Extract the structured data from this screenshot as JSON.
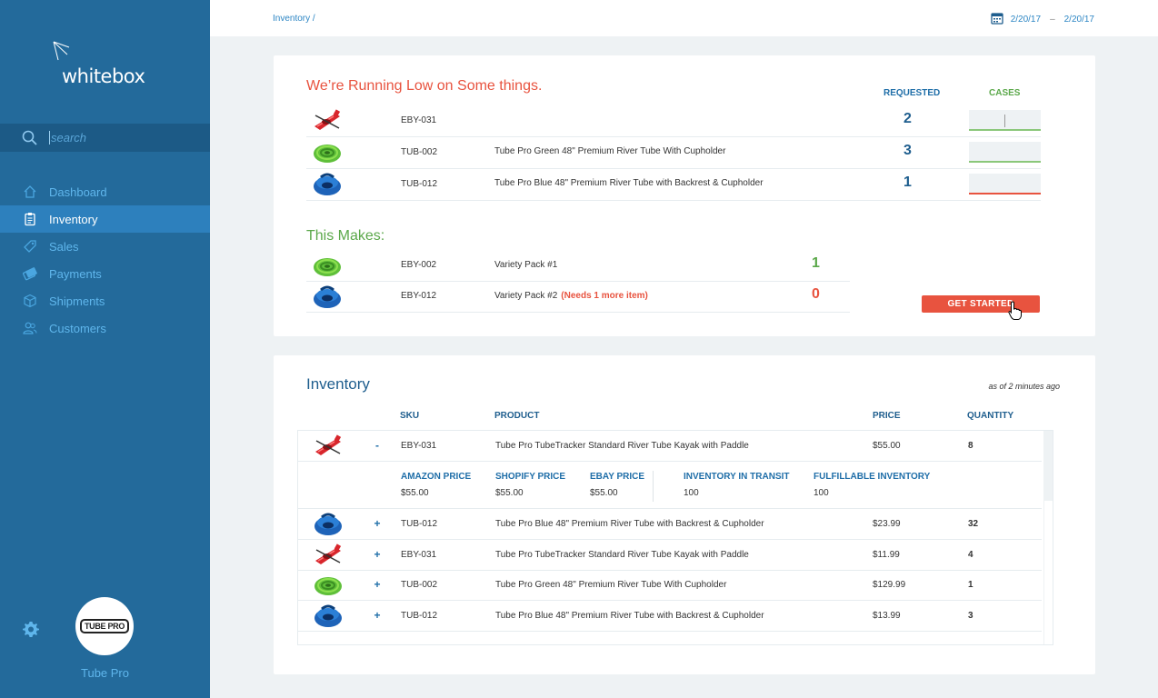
{
  "app": {
    "logo": "whitebox",
    "brand_name": "Tube Pro",
    "brand_badge": "TUBE PRO"
  },
  "search": {
    "placeholder": "search"
  },
  "nav": [
    {
      "label": "Dashboard",
      "icon": "home-icon"
    },
    {
      "label": "Inventory",
      "icon": "clipboard-icon",
      "active": true
    },
    {
      "label": "Sales",
      "icon": "tag-icon"
    },
    {
      "label": "Payments",
      "icon": "payments-icon"
    },
    {
      "label": "Shipments",
      "icon": "box-icon"
    },
    {
      "label": "Customers",
      "icon": "users-icon"
    }
  ],
  "breadcrumb": "Inventory /",
  "date_range": {
    "start": "2/20/17",
    "separator": "–",
    "end": "2/20/17"
  },
  "low_stock": {
    "title": "We’re Running Low on Some things.",
    "col_requested": "REQUESTED",
    "col_cases": "CASES",
    "rows": [
      {
        "sku": "EBY-031",
        "product": "",
        "requested": "2",
        "thumb": "kayak-red"
      },
      {
        "sku": "TUB-002",
        "product": "Tube Pro Green 48\" Premium River Tube With Cupholder",
        "requested": "3",
        "thumb": "tube-green"
      },
      {
        "sku": "TUB-012",
        "product": "Tube Pro Blue 48\" Premium River Tube with Backrest & Cupholder",
        "requested": "1",
        "thumb": "tube-blue"
      }
    ]
  },
  "makes": {
    "title": "This Makes:",
    "rows": [
      {
        "sku": "EBY-002",
        "product": "Variety Pack #1",
        "note": "",
        "qty": "1",
        "thumb": "tube-green"
      },
      {
        "sku": "EBY-012",
        "product": "Variety Pack #2",
        "note": "(Needs 1 more item)",
        "qty": "0",
        "thumb": "tube-blue"
      }
    ],
    "button": "GET STARTED"
  },
  "inventory": {
    "title": "Inventory",
    "as_of": "as of 2 minutes ago",
    "headers": {
      "sku": "SKU",
      "product": "PRODUCT",
      "price": "PRICE",
      "quantity": "QUANTITY"
    },
    "rows": [
      {
        "toggle": "-",
        "sku": "EBY-031",
        "product": "Tube Pro TubeTracker Standard River Tube Kayak with Paddle",
        "price": "$55.00",
        "qty": "8",
        "thumb": "kayak-red"
      },
      {
        "toggle": "+",
        "sku": "TUB-012",
        "product": "Tube Pro Blue 48\" Premium River Tube with Backrest & Cupholder",
        "price": "$23.99",
        "qty": "32",
        "thumb": "tube-blue"
      },
      {
        "toggle": "+",
        "sku": "EBY-031",
        "product": "Tube Pro TubeTracker Standard River Tube Kayak with Paddle",
        "price": "$11.99",
        "qty": "4",
        "thumb": "kayak-red"
      },
      {
        "toggle": "+",
        "sku": "TUB-002",
        "product": "Tube Pro Green 48\" Premium River Tube With Cupholder",
        "price": "$129.99",
        "qty": "1",
        "thumb": "tube-green"
      },
      {
        "toggle": "+",
        "sku": "TUB-012",
        "product": "Tube Pro Blue 48\" Premium River Tube with Backrest & Cupholder",
        "price": "$13.99",
        "qty": "3",
        "thumb": "tube-blue"
      }
    ],
    "detail": {
      "amazon_label": "AMAZON PRICE",
      "amazon_value": "$55.00",
      "shopify_label": "SHOPIFY PRICE",
      "shopify_value": "$55.00",
      "ebay_label": "EBAY PRICE",
      "ebay_value": "$55.00",
      "transit_label": "INVENTORY IN TRANSIT",
      "transit_value": "100",
      "fulfillable_label": "FULFILLABLE INVENTORY",
      "fulfillable_value": "100"
    }
  },
  "colors": {
    "sidebar": "#236a9b",
    "active_nav": "#2d80bd",
    "accent_red": "#e8533f",
    "accent_green": "#5ba84a",
    "accent_blue": "#1f5e8e"
  }
}
